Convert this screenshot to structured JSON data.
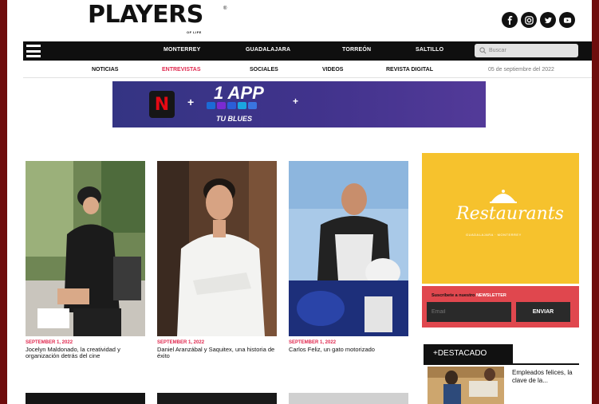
{
  "brand": {
    "logo": "PLAYERS",
    "reg_mark": "®",
    "tagline": "OF LIFE"
  },
  "social_icons": [
    "facebook-icon",
    "instagram-icon",
    "twitter-icon",
    "youtube-icon"
  ],
  "topnav": {
    "cities": [
      "MONTERREY",
      "GUADALAJARA",
      "TORREÓN",
      "SALTILLO"
    ],
    "search_placeholder": "Buscar"
  },
  "subnav": {
    "links": [
      {
        "label": "NOTICIAS",
        "active": false
      },
      {
        "label": "ENTREVISTAS",
        "active": true
      },
      {
        "label": "SOCIALES",
        "active": false
      },
      {
        "label": "VIDEOS",
        "active": false
      },
      {
        "label": "REVISTA DIGITAL",
        "active": false
      }
    ],
    "date": "05 de septiembre del 2022"
  },
  "banner": {
    "logo_letter": "N",
    "plus": "+",
    "title": "1 APP",
    "subtitle": "TU BLUES"
  },
  "articles": [
    {
      "date": "SEPTEMBER 1, 2022",
      "title": "Jocelyn Maldonado, la creatividad y organización detrás del cine"
    },
    {
      "date": "SEPTEMBER 1, 2022",
      "title": "Daniel Aranzábal y Saquitex, una historia de éxito"
    },
    {
      "date": "SEPTEMBER 1, 2022",
      "title": "Carlos Feliz, un gato motorizado"
    }
  ],
  "ad": {
    "text": "Restaurants",
    "caption": "GUADALAJARA · MONTERREY"
  },
  "newsletter": {
    "label": "Suscríbete a nuestro",
    "label_highlight": "NEWSLETTER",
    "email_placeholder": "Email",
    "submit": "ENVIAR"
  },
  "featured": {
    "heading": "+DESTACADO",
    "title": "Empleados felices, la clave de la..."
  },
  "colors": {
    "accent": "#e0284e",
    "frame": "#6e0d0d",
    "ad_yellow": "#f6c22d",
    "newsletter_red": "#e0474e"
  }
}
